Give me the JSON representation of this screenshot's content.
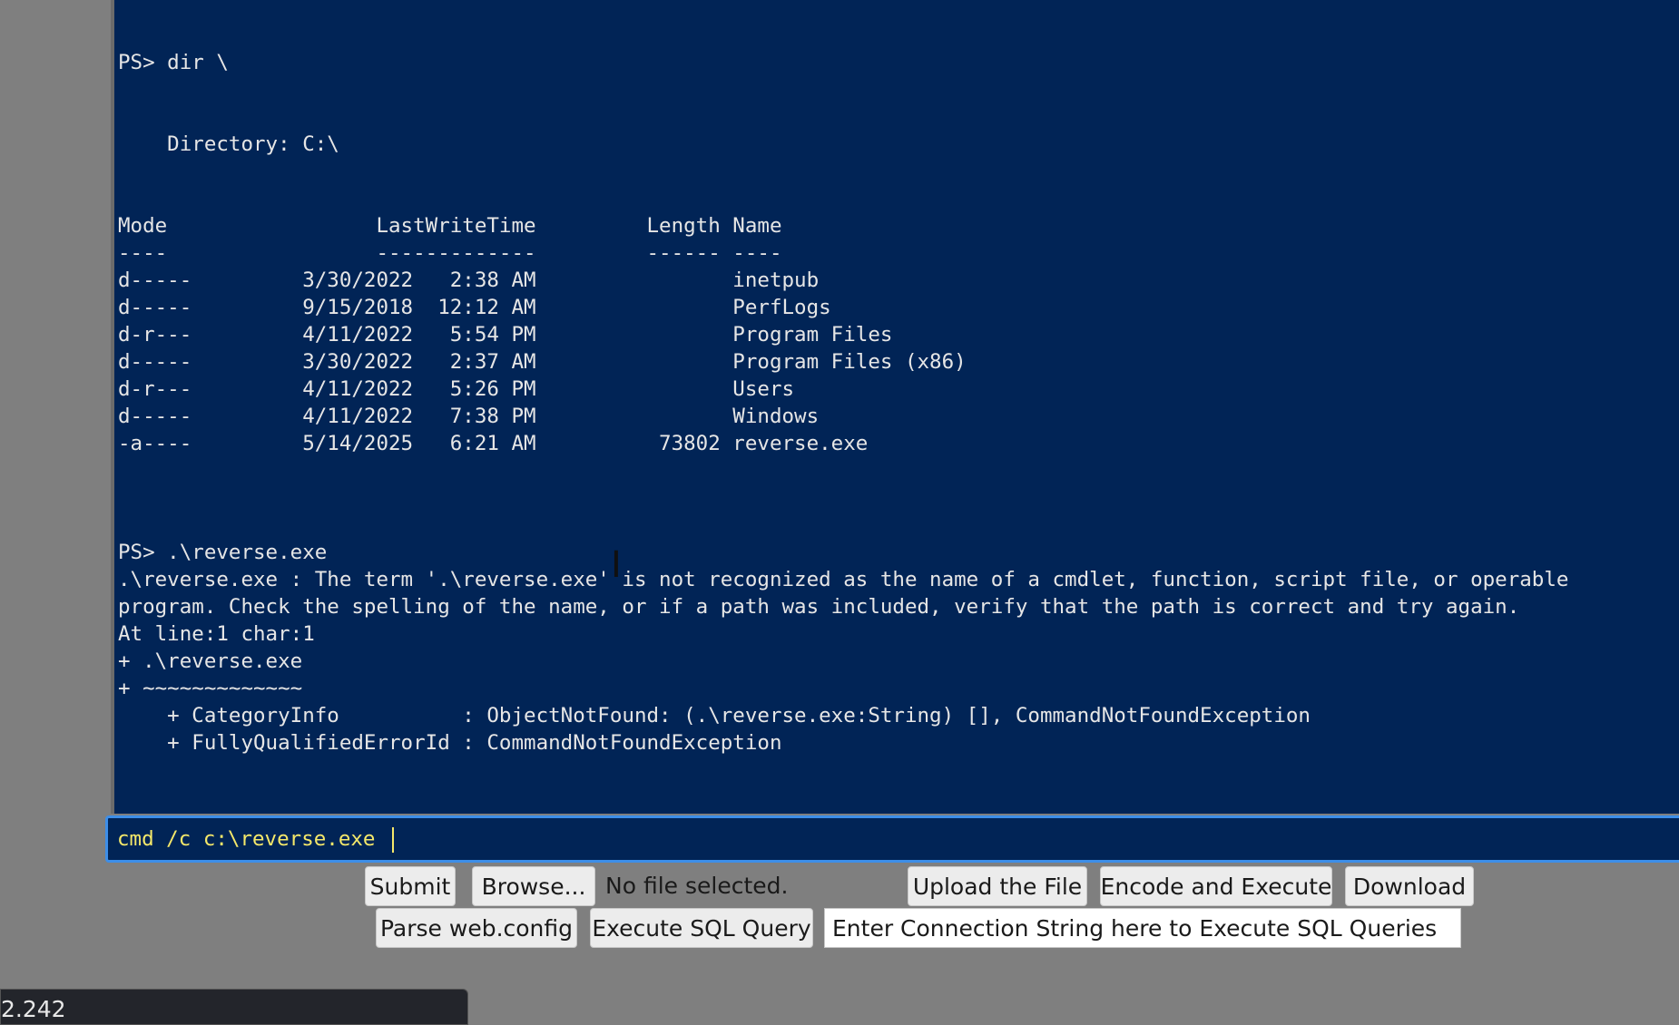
{
  "console": {
    "output": "PS> dir \\\n\n\n    Directory: C:\\\n\n\nMode                 LastWriteTime         Length Name\n----                 -------------         ------ ----\nd-----         3/30/2022   2:38 AM                inetpub\nd-----         9/15/2018  12:12 AM                PerfLogs\nd-r---         4/11/2022   5:54 PM                Program Files\nd-----         3/30/2022   2:37 AM                Program Files (x86)\nd-r---         4/11/2022   5:26 PM                Users\nd-----         4/11/2022   7:38 PM                Windows\n-a----         5/14/2025   6:21 AM          73802 reverse.exe\n\n\n\nPS> .\\reverse.exe\n.\\reverse.exe : The term '.\\reverse.exe' is not recognized as the name of a cmdlet, function, script file, or operable\nprogram. Check the spelling of the name, or if a path was included, verify that the path is correct and try again.\nAt line:1 char:1\n+ .\\reverse.exe\n+ ~~~~~~~~~~~~~\n    + CategoryInfo          : ObjectNotFound: (.\\reverse.exe:String) [], CommandNotFoundException\n    + FullyQualifiedErrorId : CommandNotFoundException"
  },
  "command_input": {
    "value": "cmd /c c:\\reverse.exe"
  },
  "controls": {
    "submit_label": "Submit",
    "browse_label": "Browse...",
    "file_status": "No file selected.",
    "upload_label": "Upload the File",
    "encode_execute_label": "Encode and Execute",
    "download_label": "Download",
    "parse_webconfig_label": "Parse web.config",
    "execute_sql_label": "Execute SQL Query",
    "connection_string_value": "Enter Connection String here to Execute SQL Queries"
  },
  "status_bar": {
    "text": "2.242"
  },
  "colors": {
    "console_bg": "#012456",
    "input_text": "#f5e86a",
    "input_border": "#3d8ee8"
  },
  "icons": {
    "cursor": "text-cursor-icon"
  }
}
